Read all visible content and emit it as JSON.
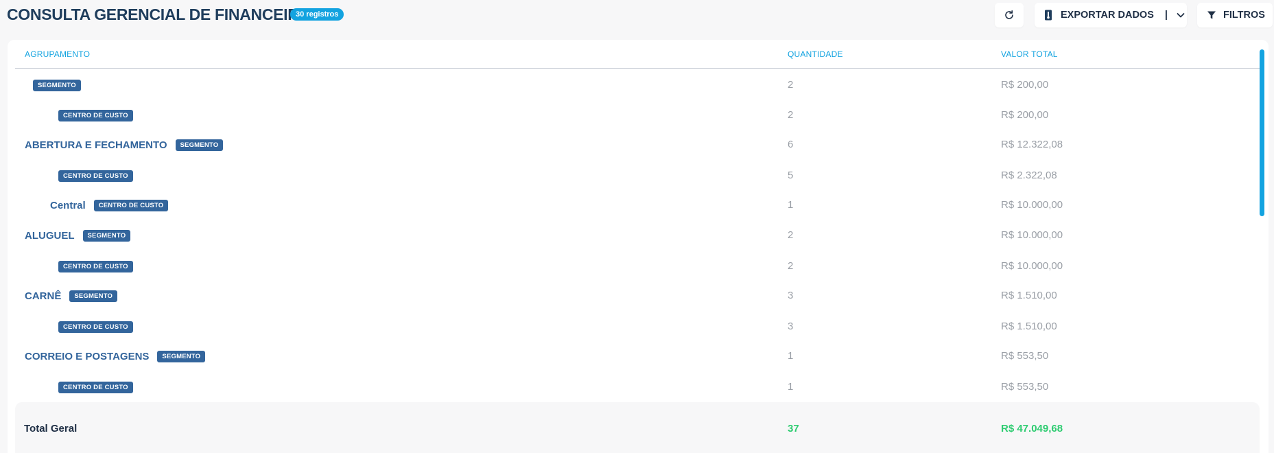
{
  "header": {
    "title": "CONSULTA GERENCIAL DE FINANCEIRO",
    "count_badge": "30 registros",
    "refresh_icon": "refresh-icon",
    "export_label": "EXPORTAR DADOS",
    "export_separator": "|",
    "export_icon": "thermometer-icon",
    "filter_label": "FILTROS",
    "filter_icon": "funnel-icon"
  },
  "table": {
    "columns": [
      "AGRUPAMENTO",
      "QUANTIDADE",
      "VALOR TOTAL"
    ],
    "rows": [
      {
        "name": "",
        "tag": "SEGMENTO",
        "level": 1,
        "qty": "2",
        "value": "R$ 200,00"
      },
      {
        "name": "",
        "tag": "CENTRO DE CUSTO",
        "level": 2,
        "qty": "2",
        "value": "R$ 200,00"
      },
      {
        "name": "ABERTURA E FECHAMENTO",
        "tag": "SEGMENTO",
        "level": 0,
        "qty": "6",
        "value": "R$ 12.322,08"
      },
      {
        "name": "",
        "tag": "CENTRO DE CUSTO",
        "level": 2,
        "qty": "5",
        "value": "R$ 2.322,08"
      },
      {
        "name": "Central",
        "tag": "CENTRO DE CUSTO",
        "level": 3,
        "qty": "1",
        "value": "R$ 10.000,00"
      },
      {
        "name": "ALUGUEL",
        "tag": "SEGMENTO",
        "level": 0,
        "qty": "2",
        "value": "R$ 10.000,00"
      },
      {
        "name": "",
        "tag": "CENTRO DE CUSTO",
        "level": 2,
        "qty": "2",
        "value": "R$ 10.000,00"
      },
      {
        "name": "CARNÊ",
        "tag": "SEGMENTO",
        "level": 0,
        "qty": "3",
        "value": "R$ 1.510,00"
      },
      {
        "name": "",
        "tag": "CENTRO DE CUSTO",
        "level": 2,
        "qty": "3",
        "value": "R$ 1.510,00"
      },
      {
        "name": "CORREIO E POSTAGENS",
        "tag": "SEGMENTO",
        "level": 0,
        "qty": "1",
        "value": "R$ 553,50"
      },
      {
        "name": "",
        "tag": "CENTRO DE CUSTO",
        "level": 2,
        "qty": "1",
        "value": "R$ 553,50"
      }
    ],
    "total": {
      "label": "Total Geral",
      "qty": "37",
      "value": "R$ 47.049,68"
    }
  },
  "colors": {
    "accent": "#13a3e0",
    "tag": "#33659c",
    "total": "#2ecc71"
  }
}
